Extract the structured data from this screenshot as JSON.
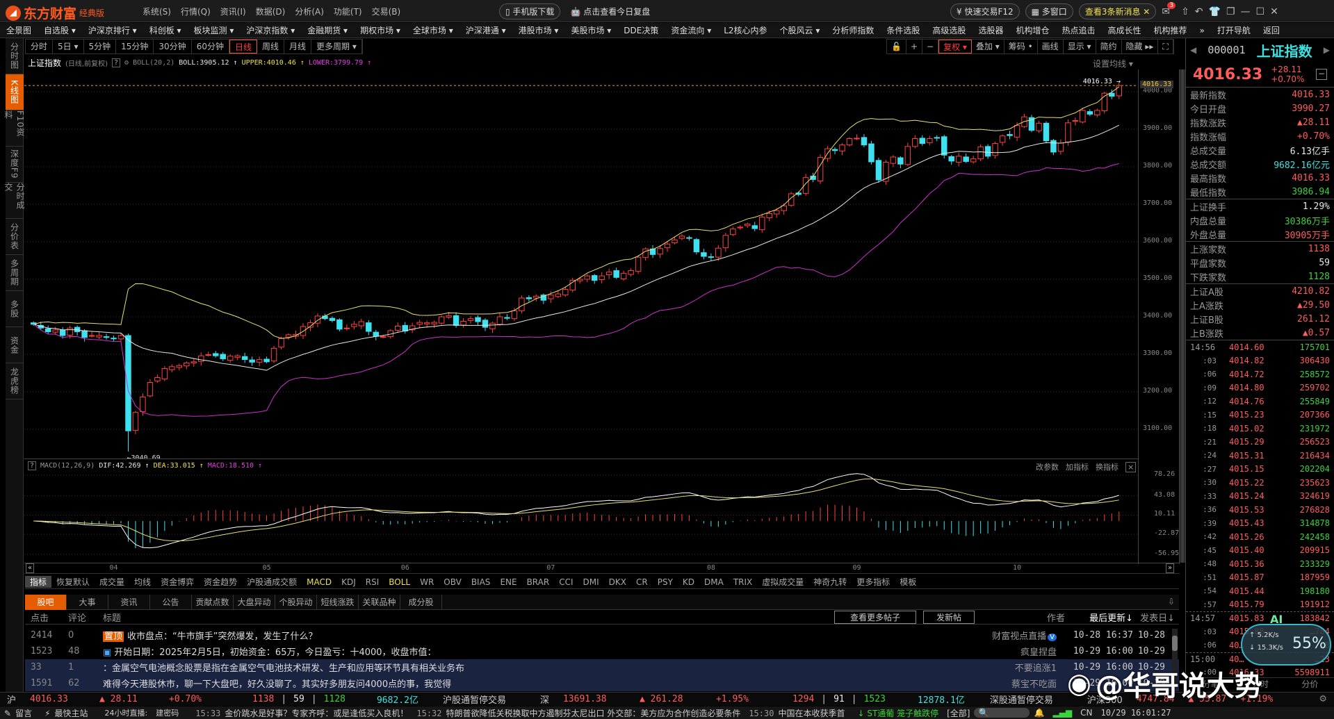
{
  "app": {
    "brand": "东方财富",
    "edition": "经典版",
    "menus": [
      "系统(S)",
      "行情(Q)",
      "资讯(I)",
      "数据(D)",
      "分析(A)",
      "功能(T)",
      "交易(B)"
    ],
    "mobile_download": "手机版下载",
    "daily_review": "点击查看今日复盘",
    "quick_trade": "快速交易F12",
    "multi_window": "多窗口",
    "messages": "查看3条新消息",
    "msg_badge": "3"
  },
  "nav": [
    "全景图",
    "自选股 ▾",
    "沪深京排行 ▾",
    "科创板 ▾",
    "板块监测 ▾",
    "沪深京指数 ▾",
    "金融期货 ▾",
    "期权市场 ▾",
    "全球市场 ▾",
    "沪深港通 ▾",
    "港股市场 ▾",
    "美股市场 ▾",
    "DDE决策",
    "资金流向 ▾",
    "L2核心内参",
    "个股风云 ▾",
    "分析师指数",
    "条件选股",
    "高级选股",
    "选股器",
    "机构增仓",
    "热点追击",
    "高成长性",
    "机构推荐",
    "»",
    "打开导航",
    "返回"
  ],
  "sidebar": [
    "分时图",
    "K线图",
    "F10资料",
    "深度F9",
    "分时成交",
    "分价表",
    "多周期",
    "多股",
    "资金",
    "龙虎榜"
  ],
  "periods": [
    "分时",
    "5日 ▾",
    "5分钟",
    "15分钟",
    "30分钟",
    "60分钟",
    "日线",
    "周线",
    "月线",
    "更多周期 ▾"
  ],
  "active_period": "日线",
  "tools": [
    "🔓",
    "+",
    "−",
    "复权 ▾",
    "叠加 ▾",
    "筹码 •",
    "画线",
    "显示 ▾",
    "简约",
    "隐藏 ▸▸",
    "⛶"
  ],
  "set_ma": "设置均线 ▾",
  "chart_head": {
    "name": "上证指数",
    "mode": "(日线,前复权)",
    "help": "?",
    "boll_param": "BOLL(20,2)",
    "boll": "BOLL:3905.12 ↑",
    "upper": "UPPER:4010.46 ↑",
    "lower": "LOWER:3799.79 ↑"
  },
  "macd_head": {
    "help": "?",
    "param": "MACD(12,26,9)",
    "dif": "DIF:42.269 ↑",
    "dea": "DEA:33.015 ↑",
    "macd": "MACD:18.510 ↑",
    "actions": [
      "改参数",
      "加指标",
      "换指标"
    ],
    "close": "×"
  },
  "colors": {
    "up": "#ff4040",
    "down": "#3fe0f0",
    "boll_mid": "#e8e8e8",
    "boll_upper": "#e8e070",
    "boll_lower": "#d030d0",
    "accent": "#e65c00"
  },
  "chart_data": {
    "type": "candlestick",
    "y_ticks": [
      "4000.00",
      "3900.00",
      "3800.00",
      "3700.00",
      "3600.00",
      "3500.00",
      "3400.00",
      "3300.00",
      "3200.00",
      "3100.00"
    ],
    "ylim": [
      3020,
      4060
    ],
    "last_price": "4016.33",
    "low_marker": {
      "value": 3040.69,
      "label": "←3040.69"
    },
    "month_labels": [
      "04",
      "05",
      "06",
      "07",
      "08",
      "09",
      "10"
    ],
    "month_start_index": [
      11,
      32,
      51,
      71,
      93,
      113,
      135
    ],
    "closes": [
      3380,
      3370,
      3360,
      3365,
      3350,
      3370,
      3360,
      3345,
      3350,
      3350,
      3345,
      3342,
      3350,
      3096,
      3145,
      3186,
      3225,
      3238,
      3262,
      3267,
      3270,
      3277,
      3280,
      3296,
      3299,
      3296,
      3288,
      3295,
      3296,
      3286,
      3279,
      3286,
      3280,
      3316,
      3342,
      3352,
      3353,
      3374,
      3384,
      3402,
      3395,
      3390,
      3367,
      3370,
      3380,
      3387,
      3361,
      3348,
      3347,
      3363,
      3375,
      3362,
      3376,
      3385,
      3384,
      3385,
      3400,
      3403,
      3377,
      3388,
      3395,
      3387,
      3372,
      3383,
      3400,
      3396,
      3416,
      3450,
      3448,
      3455,
      3444,
      3458,
      3461,
      3473,
      3497,
      3500,
      3509,
      3497,
      3509,
      3519,
      3505,
      3516,
      3523,
      3559,
      3581,
      3566,
      3582,
      3594,
      3605,
      3615,
      3609,
      3573,
      3561,
      3559,
      3583,
      3617,
      3634,
      3639,
      3647,
      3635,
      3666,
      3675,
      3683,
      3696,
      3728,
      3726,
      3771,
      3766,
      3825,
      3848,
      3843,
      3858,
      3875,
      3876,
      3858,
      3813,
      3765,
      3812,
      3826,
      3807,
      3854,
      3875,
      3862,
      3875,
      3876,
      3831,
      3815,
      3828,
      3814,
      3821,
      3853,
      3828,
      3862,
      3882,
      3883,
      3910,
      3933,
      3897,
      3916,
      3869,
      3839,
      3863,
      3917,
      3923,
      3950,
      3940,
      3950,
      3996,
      3988,
      4016.33
    ],
    "macd_ticks": [
      "78.26",
      "43.08",
      "10.11",
      "-22.87",
      "-56.95"
    ],
    "macd_ylim": [
      -56.95,
      78.26
    ]
  },
  "indicators": [
    "指标",
    "恢复默认",
    "成交量",
    "均线",
    "资金博弈",
    "资金趋势",
    "沪股通成交额",
    "MACD",
    "KDJ",
    "RSI",
    "BOLL",
    "WR",
    "OBV",
    "BIAS",
    "ENE",
    "BRAR",
    "CCI",
    "DMI",
    "DKX",
    "CR",
    "PSY",
    "KD",
    "DMA",
    "TRIX",
    "虚拟成交量",
    "神奇九转",
    "更多指标",
    "模板"
  ],
  "news": {
    "tabs": [
      "股吧",
      "大事",
      "资讯",
      "公告",
      "贡献点数",
      "大盘异动",
      "个股异动",
      "短线涨跌",
      "关联品种",
      "成分股"
    ],
    "headers": {
      "clicks": "点击",
      "comments": "评论",
      "title": "标题",
      "more": "查看更多帖子",
      "new_post": "发新帖",
      "author": "作者",
      "updated": "最后更新↓",
      "posted": "发表日↓"
    },
    "rows": [
      {
        "clicks": "2414",
        "comments": "0",
        "tag": "置顶",
        "title": "收市盘点：“牛市旗手”突然爆发，发生了什么？",
        "author": "财富视点直播",
        "verified": "V",
        "updated": "10-28 16:37",
        "posted": "10-28"
      },
      {
        "clicks": "1523",
        "comments": "48",
        "tag": "",
        "title": "开始日期：2025年2月5日，初始资金：65万，今日盈亏：十4000，收盘市值：",
        "author": "疯皇捏盘",
        "verified": "",
        "updated": "10-29 16:00",
        "posted": "10-29"
      },
      {
        "clicks": "33",
        "comments": "1",
        "tag": "",
        "title": "：金属空气电池概念股票是指在金属空气电池技术研发、生产和应用等环节具有相关业务布",
        "author": "不要追涨1",
        "verified": "",
        "updated": "10-29 16:00",
        "posted": "10-29"
      },
      {
        "clicks": "1591",
        "comments": "62",
        "tag": "",
        "title": "难得今天港股休市，聊一下大盘吧，好久没聊了。其实好多朋友问4000点的事，我觉得",
        "author": "蔡宝不吃面",
        "verified": "",
        "updated": "10-29 16:00",
        "posted": "10-29"
      }
    ]
  },
  "quote": {
    "code": "000001",
    "name": "上证指数",
    "price": "4016.33",
    "change": "+28.11",
    "pct": "+0.70%",
    "groups": [
      [
        {
          "k": "最新指数",
          "v": "4016.33",
          "c": "red"
        },
        {
          "k": "今日开盘",
          "v": "3990.27",
          "c": "red"
        },
        {
          "k": "指数涨跌",
          "v": "▲28.11",
          "c": "red"
        },
        {
          "k": "指数涨幅",
          "v": "+0.70%",
          "c": "red"
        },
        {
          "k": "总成交量",
          "v": "6.13亿手",
          "c": "wht"
        },
        {
          "k": "总成交额",
          "v": "9682.16亿元",
          "c": "cyan"
        },
        {
          "k": "最高指数",
          "v": "4016.33",
          "c": "red"
        },
        {
          "k": "最低指数",
          "v": "3986.94",
          "c": "grn"
        }
      ],
      [
        {
          "k": "上证换手",
          "v": "1.29%",
          "c": "wht"
        },
        {
          "k": "内盘总量",
          "v": "30386万手",
          "c": "grn"
        },
        {
          "k": "外盘总量",
          "v": "30905万手",
          "c": "red"
        }
      ],
      [
        {
          "k": "上涨家数",
          "v": "1138",
          "c": "red"
        },
        {
          "k": "平盘家数",
          "v": "59",
          "c": "wht"
        },
        {
          "k": "下跌家数",
          "v": "1128",
          "c": "grn"
        }
      ],
      [
        {
          "k": "上证A股",
          "v": "4210.82",
          "c": "red"
        },
        {
          "k": "上A涨跌",
          "v": "▲29.50",
          "c": "red"
        },
        {
          "k": "上证B股",
          "v": "261.12",
          "c": "red"
        },
        {
          "k": "上B涨跌",
          "v": "▲0.57",
          "c": "red"
        }
      ]
    ],
    "ticks": [
      {
        "t": "14:56",
        "p": "4014.60",
        "v": "175701",
        "c": "grn"
      },
      {
        "t": ":03",
        "p": "4014.82",
        "v": "306430",
        "c": "red"
      },
      {
        "t": ":06",
        "p": "4014.72",
        "v": "258572",
        "c": "grn"
      },
      {
        "t": ":09",
        "p": "4014.80",
        "v": "259702",
        "c": "red"
      },
      {
        "t": ":12",
        "p": "4014.76",
        "v": "255849",
        "c": "grn"
      },
      {
        "t": ":15",
        "p": "4015.23",
        "v": "207366",
        "c": "red"
      },
      {
        "t": ":18",
        "p": "4015.02",
        "v": "231972",
        "c": "grn"
      },
      {
        "t": ":21",
        "p": "4015.29",
        "v": "256523",
        "c": "red"
      },
      {
        "t": ":24",
        "p": "4015.31",
        "v": "216434",
        "c": "red"
      },
      {
        "t": ":27",
        "p": "4015.15",
        "v": "202204",
        "c": "grn"
      },
      {
        "t": ":30",
        "p": "4015.22",
        "v": "235623",
        "c": "red"
      },
      {
        "t": ":33",
        "p": "4015.24",
        "v": "324619",
        "c": "red"
      },
      {
        "t": ":36",
        "p": "4015.53",
        "v": "276828",
        "c": "red"
      },
      {
        "t": ":39",
        "p": "4015.43",
        "v": "314878",
        "c": "grn"
      },
      {
        "t": ":42",
        "p": "4015.26",
        "v": "242458",
        "c": "grn"
      },
      {
        "t": ":45",
        "p": "4015.40",
        "v": "209915",
        "c": "red"
      },
      {
        "t": ":48",
        "p": "4015.36",
        "v": "233329",
        "c": "grn"
      },
      {
        "t": ":51",
        "p": "4015.87",
        "v": "187959",
        "c": "red"
      },
      {
        "t": ":54",
        "p": "4015.44",
        "v": "198180",
        "c": "grn"
      },
      {
        "t": ":57",
        "p": "4015.79",
        "v": "191912",
        "c": "red"
      },
      {
        "t": "14:57",
        "p": "4015.83",
        "v": "183842",
        "c": "red"
      },
      {
        "t": ":03",
        "p": "4015.88",
        "v": "…784",
        "c": "red"
      },
      {
        "t": ":06",
        "p": "40…",
        "v": "…8",
        "c": "grn"
      },
      {
        "t": "15:00",
        "p": "40…",
        "v": "…23",
        "c": "red"
      },
      {
        "t": ":00",
        "p": "4016.33",
        "v": "5598911",
        "c": "red"
      }
    ],
    "bottom_tabs": [
      "分笔",
      "分时",
      "分价"
    ]
  },
  "ai_widget": {
    "label": "AI",
    "up": "5.2K/s",
    "down": "15.3K/s",
    "pct": "55%"
  },
  "status": {
    "sh": "沪",
    "sh_price": "4016.33",
    "sh_chg": "▲ 28.11",
    "sh_pct": "+0.70%",
    "sh_up": "1138",
    "sh_flat": "59",
    "sh_down": "1128",
    "sh_amt": "9682.2亿",
    "sh_connect": "沪股通暂停交易",
    "sz": "深",
    "sz_price": "13691.38",
    "sz_chg": "▲ 261.28",
    "sz_pct": "+1.95%",
    "sz_up": "1294",
    "sz_flat": "91",
    "sz_down": "1523",
    "sz_amt": "12878.1亿",
    "sz_connect": "深股通暂停交易",
    "hs300": "沪深300",
    "hs_price": "4747.84",
    "hs_chg": "▲ 55.87",
    "hs_pct": "+1.19%"
  },
  "ticker": {
    "msg": "留言",
    "fast": "最快主站",
    "live": "24小时直播:",
    "live2": "建密码",
    "items": [
      {
        "t": "15:33",
        "s": "金价跳水是好事？专家齐呼：或是逢低买入良机！"
      },
      {
        "t": "15:32",
        "s": "特朗普欲降低关税换取中方遏制芬太尼出口 外交部：美方应为合作创造必要条件"
      },
      {
        "t": "15:30",
        "s": "中国在本收获季首"
      }
    ],
    "alert": "↓ ST通葡  笼子触跌停",
    "all": "[全部]",
    "region": "CN",
    "datetime": "10/29 16:01:27"
  },
  "watermark": "@华哥说大势"
}
